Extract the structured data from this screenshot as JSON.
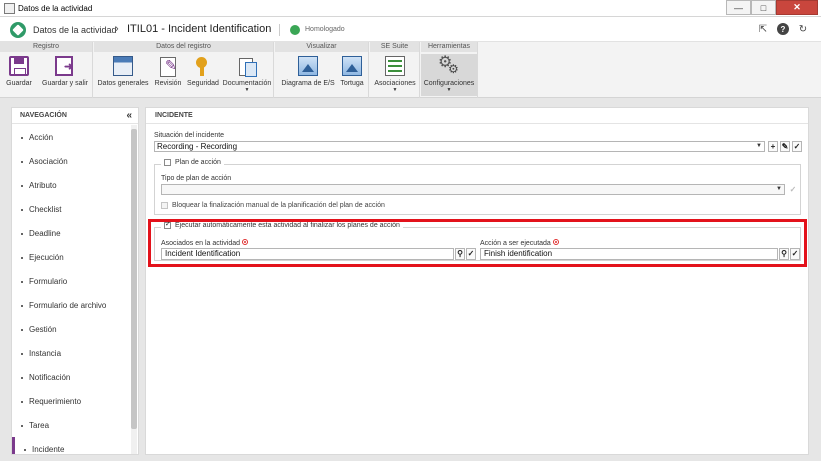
{
  "window": {
    "title": "Datos de la actividad",
    "minimize": "—",
    "maximize": "□",
    "close": "✕"
  },
  "header": {
    "breadcrumb": "Datos de la actividad",
    "separator": "›",
    "current": "ITIL01 - Incident Identification",
    "status": "Homologado"
  },
  "ribbon": {
    "groups": [
      {
        "label": "Registro"
      },
      {
        "label": "Datos del registro"
      },
      {
        "label": "Visualizar"
      },
      {
        "label": "SE Suite"
      },
      {
        "label": "Herramientas"
      }
    ],
    "buttons": {
      "save": "Guardar",
      "save_exit": "Guardar y salir",
      "general": "Datos generales",
      "review": "Revisión",
      "security": "Seguridad",
      "documents": "Documentación",
      "es_diagram": "Diagrama de E/S",
      "turtle": "Tortuga",
      "associations": "Asociaciones",
      "settings": "Configuraciones"
    },
    "caret": "▼"
  },
  "nav": {
    "title": "NAVEGACIÓN",
    "collapse": "«",
    "items": [
      "Acción",
      "Asociación",
      "Atributo",
      "Checklist",
      "Deadline",
      "Ejecución",
      "Formulario",
      "Formulario de archivo",
      "Gestión",
      "Instancia",
      "Notificación",
      "Requerimiento",
      "Tarea",
      "Incidente"
    ]
  },
  "panel": {
    "title": "INCIDENTE",
    "incident_status_label": "Situación del incidente",
    "incident_status_value": "Recording - Recording",
    "action_plan_label": "Plan de acción",
    "action_plan_type_label": "Tipo de plan de acción",
    "action_plan_type_value": "",
    "block_manual_label": "Bloquear la finalización manual de la planificación del plan de acción",
    "auto_execute_label": "Ejecutar automáticamente esta actividad al finalizar los planes de acción",
    "associated_label": "Asociados en la actividad",
    "associated_value": "Incident Identification",
    "action_label": "Acción a ser ejecutada",
    "action_value": "Finish identification"
  },
  "icons": {
    "dropdown": "▼",
    "add": "+",
    "edit": "✎",
    "check": "✓",
    "search": "⚲",
    "pin": "⇱",
    "help": "?",
    "refresh": "↻"
  }
}
